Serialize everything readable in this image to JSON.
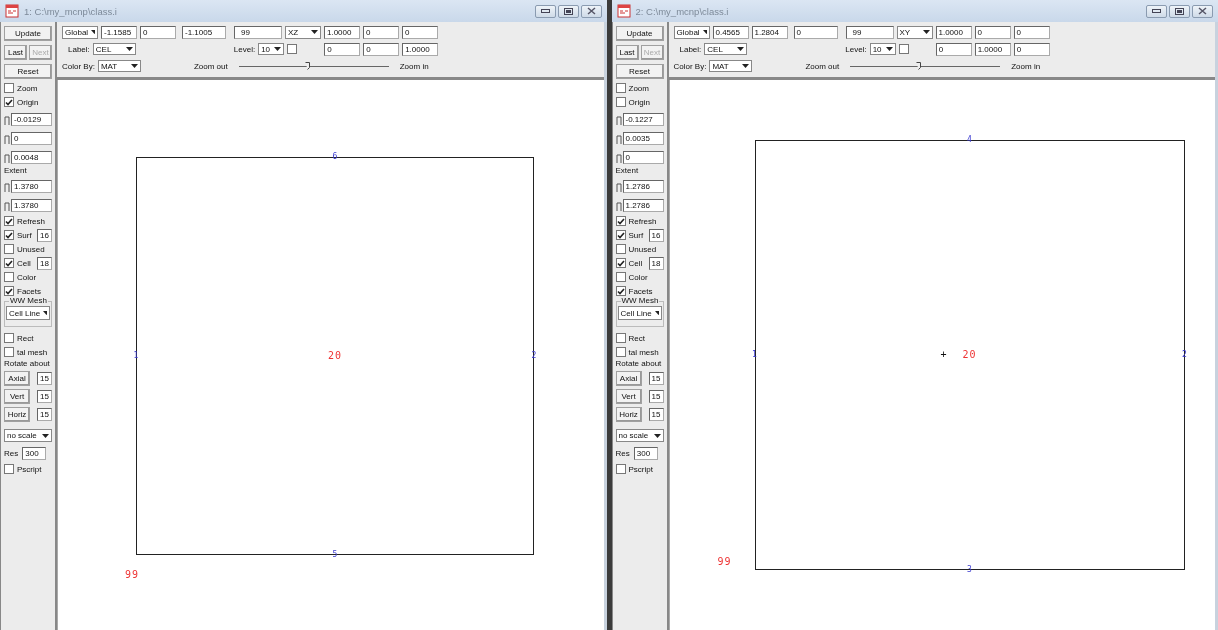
{
  "windows": [
    {
      "title": "1: C:\\my_mcnp\\class.i",
      "sidebar": [
        {
          "kind": "button",
          "label": "Update"
        },
        {
          "kind": "button-pair",
          "buttons": [
            {
              "label": "Last",
              "disabled": false
            },
            {
              "label": "Next",
              "disabled": true
            }
          ]
        },
        {
          "kind": "button",
          "label": "Reset"
        },
        {
          "kind": "checkbox",
          "label": "Zoom",
          "checked": false
        },
        {
          "kind": "checkbox",
          "label": "Origin",
          "checked": true
        },
        {
          "kind": "slider-field",
          "value": "-0.0129"
        },
        {
          "kind": "slider-field",
          "value": "0"
        },
        {
          "kind": "slider-field",
          "value": "0.0048"
        },
        {
          "kind": "label",
          "label": "Extent"
        },
        {
          "kind": "slider-field",
          "value": "1.3780"
        },
        {
          "kind": "slider-field",
          "value": "1.3780"
        },
        {
          "kind": "checkbox",
          "label": "Refresh",
          "checked": true
        },
        {
          "kind": "checkbox",
          "label": "Surf",
          "checked": true,
          "value": "16"
        },
        {
          "kind": "checkbox",
          "label": "Unused",
          "checked": false
        },
        {
          "kind": "checkbox",
          "label": "Cell",
          "checked": true,
          "value": "18"
        },
        {
          "kind": "checkbox",
          "label": "Color",
          "checked": false
        },
        {
          "kind": "checkbox",
          "label": "Facets",
          "checked": true
        },
        {
          "kind": "group",
          "label": "WW Mesh",
          "value": "Cell Line"
        },
        {
          "kind": "checkbox",
          "label": "Rect",
          "checked": false
        },
        {
          "kind": "checkbox",
          "label": "tal mesh",
          "checked": false
        },
        {
          "kind": "label",
          "label": "Rotate about"
        },
        {
          "kind": "button-field",
          "label": "Axial",
          "value": "15"
        },
        {
          "kind": "button-field",
          "label": "Vert",
          "value": "15"
        },
        {
          "kind": "button-field",
          "label": "Horiz",
          "value": "15"
        },
        {
          "kind": "dropdown",
          "value": "no scale"
        },
        {
          "kind": "label-field",
          "label": "Res",
          "value": "300"
        },
        {
          "kind": "checkbox",
          "label": "Pscript",
          "checked": false
        }
      ],
      "toolbar": {
        "row1": [
          {
            "kind": "dropdown",
            "value": "Global"
          },
          {
            "kind": "field",
            "value": "-1.1585"
          },
          {
            "kind": "field",
            "value": "0"
          },
          {
            "kind": "field",
            "value": "-1.1005"
          },
          {
            "kind": "field",
            "value": "99"
          },
          {
            "kind": "dropdown",
            "value": "XZ"
          },
          {
            "kind": "field",
            "value": "1.0000"
          },
          {
            "kind": "field",
            "value": "0"
          },
          {
            "kind": "field",
            "value": "0"
          }
        ],
        "label_label": "Label:",
        "label_value": "CEL",
        "level_label": "Level:",
        "level_value": "10",
        "level_checked": false,
        "row2_fields": [
          "0",
          "0",
          "1.0000"
        ],
        "color_label": "Color By:",
        "color_value": "MAT",
        "zoom_out": "Zoom out",
        "zoom_in": "Zoom in",
        "zoom": {
          "level": 0.44
        }
      },
      "plot": {
        "top_surface": "6",
        "left_surface": "1",
        "center_cell": "20",
        "right_surface": "2",
        "bottom_surface": "5",
        "outside_cell": "99"
      }
    },
    {
      "title": "2: C:\\my_mcnp\\class.i",
      "sidebar": [
        {
          "kind": "button",
          "label": "Update"
        },
        {
          "kind": "button-pair",
          "buttons": [
            {
              "label": "Last",
              "disabled": false
            },
            {
              "label": "Next",
              "disabled": true
            }
          ]
        },
        {
          "kind": "button",
          "label": "Reset"
        },
        {
          "kind": "checkbox",
          "label": "Zoom",
          "checked": false
        },
        {
          "kind": "checkbox",
          "label": "Origin",
          "checked": false
        },
        {
          "kind": "slider-field",
          "value": "-0.1227"
        },
        {
          "kind": "slider-field",
          "value": "0.0035"
        },
        {
          "kind": "slider-field",
          "value": "0"
        },
        {
          "kind": "label",
          "label": "Extent"
        },
        {
          "kind": "slider-field",
          "value": "1.2786"
        },
        {
          "kind": "slider-field",
          "value": "1.2786"
        },
        {
          "kind": "checkbox",
          "label": "Refresh",
          "checked": true
        },
        {
          "kind": "checkbox",
          "label": "Surf",
          "checked": true,
          "value": "16"
        },
        {
          "kind": "checkbox",
          "label": "Unused",
          "checked": false
        },
        {
          "kind": "checkbox",
          "label": "Cell",
          "checked": true,
          "value": "18"
        },
        {
          "kind": "checkbox",
          "label": "Color",
          "checked": false
        },
        {
          "kind": "checkbox",
          "label": "Facets",
          "checked": true
        },
        {
          "kind": "group",
          "label": "WW Mesh",
          "value": "Cell Line"
        },
        {
          "kind": "checkbox",
          "label": "Rect",
          "checked": false
        },
        {
          "kind": "checkbox",
          "label": "tal mesh",
          "checked": false
        },
        {
          "kind": "label",
          "label": "Rotate about"
        },
        {
          "kind": "button-field",
          "label": "Axial",
          "value": "15"
        },
        {
          "kind": "button-field",
          "label": "Vert",
          "value": "15"
        },
        {
          "kind": "button-field",
          "label": "Horiz",
          "value": "15"
        },
        {
          "kind": "dropdown",
          "value": "no scale"
        },
        {
          "kind": "label-field",
          "label": "Res",
          "value": "300"
        },
        {
          "kind": "checkbox",
          "label": "Pscript",
          "checked": false
        }
      ],
      "toolbar": {
        "row1": [
          {
            "kind": "dropdown",
            "value": "Global"
          },
          {
            "kind": "field",
            "value": "0.4565"
          },
          {
            "kind": "field",
            "value": "1.2804"
          },
          {
            "kind": "field",
            "value": "0"
          },
          {
            "kind": "field",
            "value": "99"
          },
          {
            "kind": "dropdown",
            "value": "XY"
          },
          {
            "kind": "field",
            "value": "1.0000"
          },
          {
            "kind": "field",
            "value": "0"
          },
          {
            "kind": "field",
            "value": "0"
          }
        ],
        "label_label": "Label:",
        "label_value": "CEL",
        "level_label": "Level:",
        "level_value": "10",
        "level_checked": false,
        "row2_fields": [
          "0",
          "1.0000",
          "0"
        ],
        "color_label": "Color By:",
        "color_value": "MAT",
        "zoom_out": "Zoom out",
        "zoom_in": "Zoom in",
        "zoom": {
          "level": 0.44
        }
      },
      "plot": {
        "top_surface": "4",
        "left_surface": "1",
        "origin_marker": "+",
        "center_cell": "20",
        "right_surface": "2",
        "outside_cell": "99",
        "bottom_surface": "3"
      }
    }
  ]
}
